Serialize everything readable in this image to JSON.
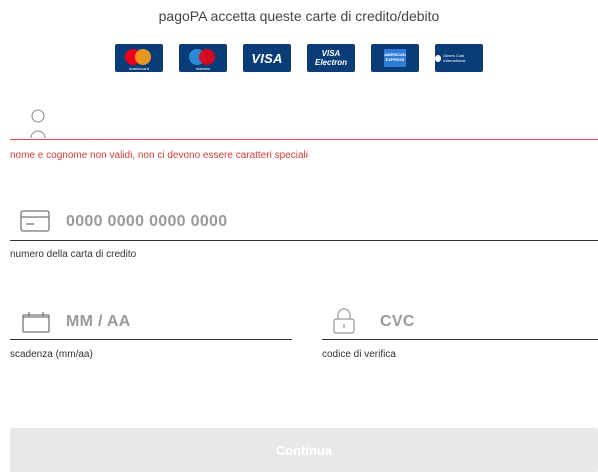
{
  "header": {
    "title": "pagoPA accetta queste carte di credito/debito"
  },
  "cards": [
    {
      "name": "Mastercard",
      "caption": "mastercard"
    },
    {
      "name": "Maestro",
      "caption": "maestro"
    },
    {
      "name": "VISA",
      "label": "VISA"
    },
    {
      "name": "VISA Electron",
      "label_top": "VISA",
      "label_bottom": "Electron"
    },
    {
      "name": "American Express",
      "label": "AMERICAN EXPRESS"
    },
    {
      "name": "Diners Club",
      "label": "Diners Club International"
    }
  ],
  "form": {
    "name_field": {
      "value": "",
      "error": "nome e cognome non validi, non ci devono essere caratteri speciali",
      "icon": "user-icon"
    },
    "card_number": {
      "placeholder": "0000 0000 0000 0000",
      "label": "numero della carta di credito",
      "icon": "credit-card-icon"
    },
    "expiry": {
      "placeholder": "MM / AA",
      "label": "scadenza (mm/aa)",
      "icon": "calendar-icon"
    },
    "cvc": {
      "placeholder": "CVC",
      "label": "codice di verifica",
      "icon": "lock-icon"
    },
    "submit_label": "Continua"
  },
  "colors": {
    "error": "#d83a3a",
    "button_disabled": "#e8e8e8",
    "placeholder": "#9a9a9a"
  }
}
